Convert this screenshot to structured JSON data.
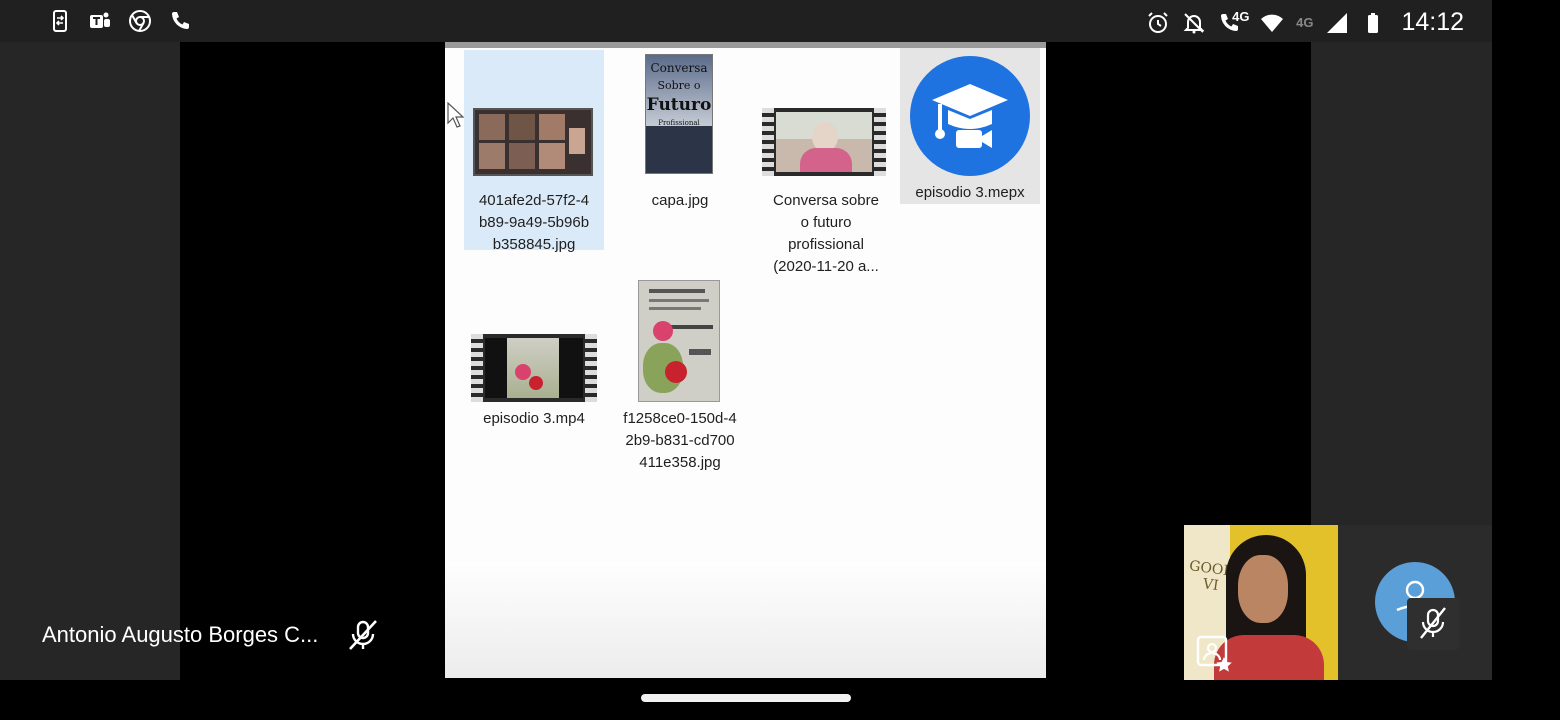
{
  "status_bar": {
    "left_icons": [
      "phone-transfer-icon",
      "teams-icon",
      "chrome-icon",
      "phone-call-icon"
    ],
    "right_icons": [
      "alarm-icon",
      "notifications-off-icon",
      "volte-call-icon",
      "wifi-icon",
      "cellular-signal-icon",
      "battery-icon"
    ],
    "network_label_1": "4G",
    "network_label_2": "4G",
    "time": "14:12"
  },
  "shared_screen": {
    "files": [
      {
        "name": "401afe2d-57f2-4b89-9a49-5b96bb358845.jpg",
        "lines": [
          "401afe2d-57f2-4",
          "b89-9a49-5b96b",
          "b358845.jpg"
        ],
        "type": "image",
        "selected": true
      },
      {
        "name": "capa.jpg",
        "lines": [
          "capa.jpg"
        ],
        "type": "image"
      },
      {
        "name": "Conversa sobre o futuro profissional (2020-11-20 a...",
        "lines": [
          "Conversa sobre",
          "o futuro",
          "profissional",
          "(2020-11-20 a..."
        ],
        "type": "video"
      },
      {
        "name": "episodio 3.mepx",
        "lines": [
          "episodio 3.mepx"
        ],
        "type": "project",
        "hovered": true
      },
      {
        "name": "episodio 3.mp4",
        "lines": [
          "episodio 3.mp4"
        ],
        "type": "video"
      },
      {
        "name": "f1258ce0-150d-42b9-b831-cd700411e358.jpg",
        "lines": [
          "f1258ce0-150d-4",
          "2b9-b831-cd700",
          "411e358.jpg"
        ],
        "type": "image"
      }
    ],
    "capa_thumbnail_text": [
      "Conversa",
      "Sobre o",
      "Futuro",
      "Profissional"
    ]
  },
  "participant": {
    "name": "Antonio Augusto Borges C...",
    "mic_state": "muted"
  },
  "self_view": {
    "wall_text": [
      "GOOD",
      "VI"
    ]
  },
  "colors": {
    "status_bar_bg": "#202020",
    "stage_bg": "#262626",
    "accent_blue": "#1e73e0",
    "avatar_blue": "#5b9fd8"
  }
}
